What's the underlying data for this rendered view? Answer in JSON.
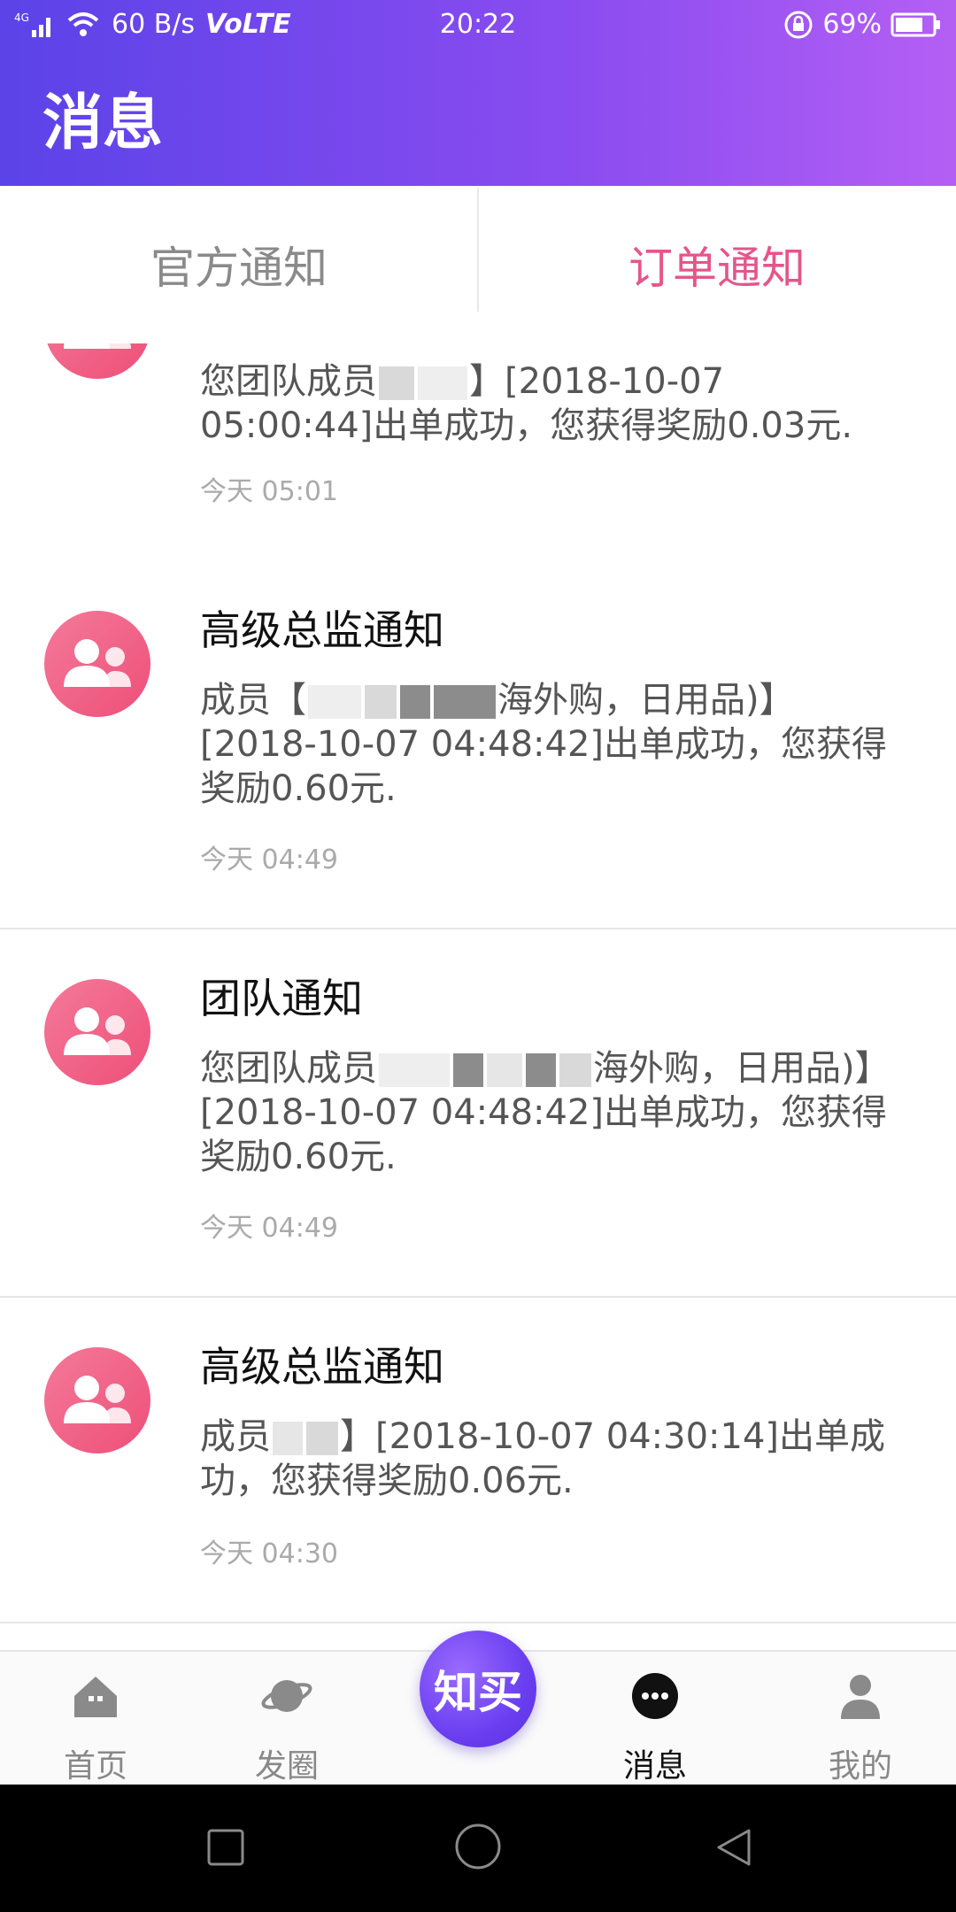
{
  "statusbar": {
    "network": "4G",
    "speed": "60 B/s",
    "volte": "VoLTE",
    "time": "20:22",
    "battery": "69%"
  },
  "header": {
    "title": "消息"
  },
  "tabs": [
    {
      "label": "官方通知",
      "active": false
    },
    {
      "label": "订单通知",
      "active": true
    }
  ],
  "messages": [
    {
      "title": "",
      "body_prefix": "您团队成员",
      "body_suffix": "】[2018-10-07 05:00:44]出单成功，您获得奖励0.03元.",
      "time": "今天 05:01"
    },
    {
      "title": "高级总监通知",
      "body_prefix": "成员【",
      "body_suffix": "海外购，日用品)】[2018-10-07 04:48:42]出单成功，您获得奖励0.60元.",
      "time": "今天 04:49"
    },
    {
      "title": "团队通知",
      "body_prefix": "您团队成员",
      "body_suffix": "海外购，日用品)】[2018-10-07 04:48:42]出单成功，您获得奖励0.60元.",
      "time": "今天 04:49"
    },
    {
      "title": "高级总监通知",
      "body_prefix": "成员",
      "body_suffix": "】[2018-10-07 04:30:14]出单成功，您获得奖励0.06元.",
      "time": "今天 04:30"
    }
  ],
  "bottom_nav": {
    "home": "首页",
    "circle": "发圈",
    "center": "知买",
    "messages": "消息",
    "mine": "我的"
  },
  "icons": {
    "home": "home-icon",
    "circle": "planet-icon",
    "messages": "chat-dots-icon",
    "mine": "person-icon",
    "avatar": "group-users-icon"
  },
  "colors": {
    "header_start": "#5b43e8",
    "header_end": "#b45ff4",
    "active_tab": "#e4568a",
    "avatar": "#ee4f78"
  }
}
